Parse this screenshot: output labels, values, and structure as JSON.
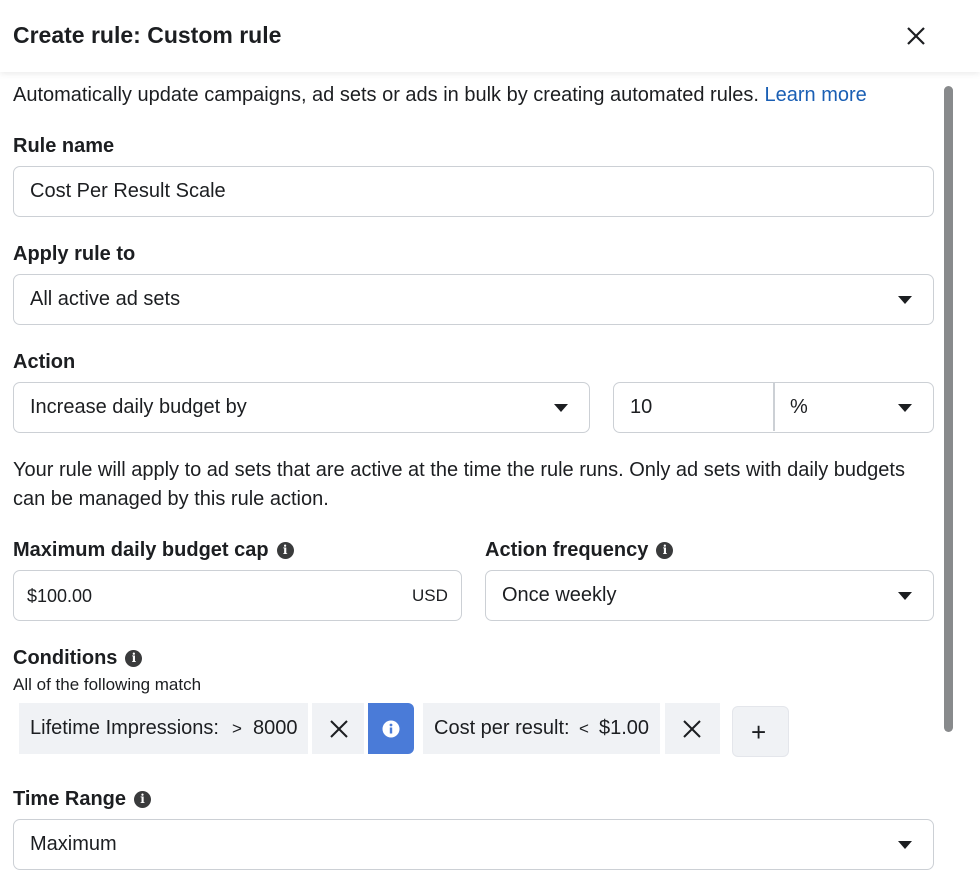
{
  "dialog": {
    "title": "Create rule: Custom rule",
    "close_icon": "close-icon"
  },
  "intro": {
    "text": "Automatically update campaigns, ad sets or ads in bulk by creating automated rules.",
    "link": "Learn more"
  },
  "rule_name": {
    "label": "Rule name",
    "value": "Cost Per Result Scale"
  },
  "apply_rule": {
    "label": "Apply rule to",
    "value": "All active ad sets"
  },
  "action": {
    "label": "Action",
    "type_value": "Increase daily budget by",
    "amount_value": "10",
    "unit_value": "%",
    "note_line1": "Your rule will apply to ad sets that are active at the time the rule runs. Only ad sets with daily budgets",
    "note_line2": "can be managed by this rule action."
  },
  "budget_cap": {
    "label": "Maximum daily budget cap",
    "value": "$100.00",
    "currency": "USD"
  },
  "frequency": {
    "label": "Action frequency",
    "value": "Once weekly"
  },
  "conditions": {
    "label": "Conditions",
    "subtitle": "All of the following match",
    "items": [
      {
        "metric": "Lifetime Impressions:",
        "operator": ">",
        "value": "8000"
      },
      {
        "metric": "Cost per result:",
        "operator": "<",
        "value": "$1.00"
      }
    ],
    "add_symbol": "+"
  },
  "time_range": {
    "label": "Time Range",
    "value": "Maximum"
  },
  "colors": {
    "link": "#1a5fb4",
    "info_chip": "#4a7bd8",
    "chip_bg": "#f0f2f5",
    "border": "#ccd0d5"
  }
}
